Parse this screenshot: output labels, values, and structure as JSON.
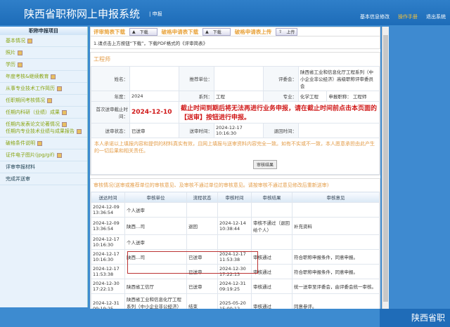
{
  "header": {
    "title": "陕西省职称网上申报系统",
    "separator": "|",
    "subtitle": "申报",
    "links": [
      "基本信息修改",
      "操作手册",
      "退出系统"
    ]
  },
  "sidebar": {
    "title": "职称申报项目",
    "items": [
      "基本情况",
      "照片",
      "学历",
      "年度考核&继续教育",
      "从事专业技术工作简历",
      "任职期间考核情况",
      "任期内科研（业绩）成果",
      "任期内发表论文论著情况",
      "任期内专业技术业绩与成果报告",
      "破格条件说明",
      "证件电子图片(jpg/gif)",
      "评审申报材料",
      "完成并送审"
    ]
  },
  "toolbar": {
    "a_label": "评审简表下载",
    "a_btn": "下载",
    "b_label": "破格申请表下载",
    "b_btn": "下载",
    "c_label": "破格申请表上传",
    "c_btn": "上传"
  },
  "tip": "1.请点击上方按钮“下载”，下载PDF格式的《评审简表》",
  "info": {
    "title": "工程师",
    "name_label": "姓名：",
    "name": "",
    "unit_label": "推荐单位：",
    "unit": "",
    "committee_label": "评委会：",
    "committee": "陕西省工业和信息化厅工程系列（中小企业非公经济）高级职称评审委员会",
    "year_label": "年度：",
    "year": "2024",
    "series_label": "系列：",
    "series": "工程",
    "major_label": "专业：",
    "major": "化学工程",
    "title_label": "申报职称：",
    "deadline_label": "首次送审截止时间：",
    "deadline": "2024-12-10",
    "deadline_note": "截止时间到期后将无法再进行业务申报，请在截止时间前点击本页面的【送审】按钮进行申报。",
    "status_label": "送审状态：",
    "status": "已送审",
    "send_time_label": "送审时间：",
    "send_time": "2024-12-17 10:16:30",
    "return_label": "退回时间：",
    "return_time": ""
  },
  "pledge": "本人承诺以上填报内容和提供的材料真实有效，且网上填报与送审资料内容完全一致。如有不实或不一致，本人愿意承担由此产生的一切后果和相关责任。",
  "review_btn": "审核结果",
  "review": {
    "title": "审核情况(送审或推荐单位的审核意见、及审核不通过单位的审核意见。请按审核不通过意见修改后重新送审)",
    "columns": [
      "送达时间",
      "审核单位",
      "流程状态",
      "审核时间",
      "审核结果",
      "审核意见"
    ],
    "rows": [
      [
        "2024-12-09 13:36:54",
        "个人送审",
        "",
        "",
        "",
        ""
      ],
      [
        "2024-12-09 13:36:54",
        "陕西…司",
        "退回",
        "2024-12-14 10:38:44",
        "审核不通过（退回给个人）",
        "补充资料"
      ],
      [
        "2024-12-17 10:16:30",
        "个人送审",
        "",
        "",
        "",
        ""
      ],
      [
        "2024-12-17 10:16:30",
        "陕西…司",
        "已送审",
        "2024-12-17 11:53:38",
        "审核通过",
        "符合职称申报条件，同意申报。"
      ],
      [
        "2024-12-17 11:53:38",
        "",
        "已送审",
        "2024-12-30 17:22:13",
        "审核通过",
        "符合职称申报条件，同意申报。"
      ],
      [
        "2024-12-30 17:22:13",
        "陕西省工信厅",
        "已送审",
        "2024-12-31 09:19:25",
        "审核通过",
        "统一送审至评委会，由评委会统一审核。"
      ],
      [
        "2024-12-31 09:19:25",
        "陕西省工业和信息化厅工程系列（中小企业非公经济）高级职称评审委员会",
        "结束",
        "2025-05-20 15:00:12",
        "审核通过",
        "同意参评。"
      ]
    ]
  },
  "footer": "陕西省职"
}
